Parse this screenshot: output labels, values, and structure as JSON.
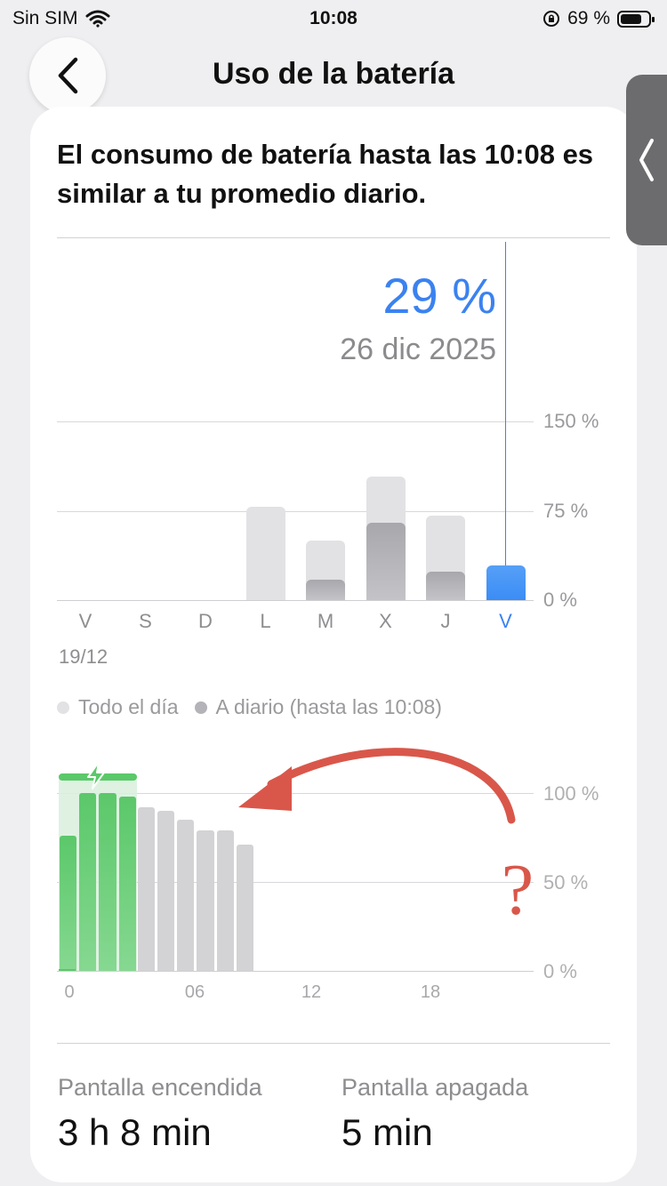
{
  "status_bar": {
    "carrier": "Sin SIM",
    "time": "10:08",
    "battery": "69 %",
    "battery_level": 0.69
  },
  "nav": {
    "title": "Uso de la batería"
  },
  "headline": "El consumo de batería hasta las 10:08 es similar a tu promedio diario.",
  "selection": {
    "value": "29 %",
    "date": "26 dic 2025"
  },
  "daily_chart": {
    "type": "bar",
    "categories": [
      "V",
      "S",
      "D",
      "L",
      "M",
      "X",
      "J",
      "V"
    ],
    "first_date": "19/12",
    "y_ticks": [
      "150 %",
      "75 %",
      "0 %"
    ],
    "ylim": [
      0,
      150
    ],
    "series": [
      {
        "name": "Todo el día",
        "values": [
          0,
          0,
          0,
          78,
          50,
          104,
          71,
          0
        ]
      },
      {
        "name": "A diario (hasta las 10:08)",
        "values": [
          0,
          0,
          0,
          0,
          17,
          65,
          24,
          29
        ]
      }
    ],
    "selected_index": 7,
    "colors": {
      "total": "#e2e2e4",
      "partial": "#b3b3b8",
      "selected": "#3b8cf5"
    }
  },
  "legend": {
    "total": "Todo el día",
    "partial": "A diario (hasta las 10:08)"
  },
  "hourly_chart": {
    "type": "bar",
    "x_ticks": [
      "0",
      "06",
      "12",
      "18"
    ],
    "y_ticks": [
      "100 %",
      "50 %",
      "0 %"
    ],
    "ylim": [
      0,
      100
    ],
    "hours": [
      0,
      1,
      2,
      3,
      4,
      5,
      6,
      7,
      8,
      9
    ],
    "levels": [
      1,
      76,
      100,
      100,
      98,
      92,
      90,
      85,
      79,
      79,
      71
    ],
    "charging_hours": [
      0,
      1,
      2,
      3
    ],
    "colors": {
      "charging": "#5bc86a",
      "discharging": "#d3d3d5",
      "charging_bg": "#d9f0dd"
    }
  },
  "annotation": {
    "mark": "?",
    "color": "#d9574a"
  },
  "stats": {
    "screen_on": {
      "label": "Pantalla encendida",
      "value": "3 h 8 min"
    },
    "screen_off": {
      "label": "Pantalla apagada",
      "value": "5 min"
    }
  }
}
